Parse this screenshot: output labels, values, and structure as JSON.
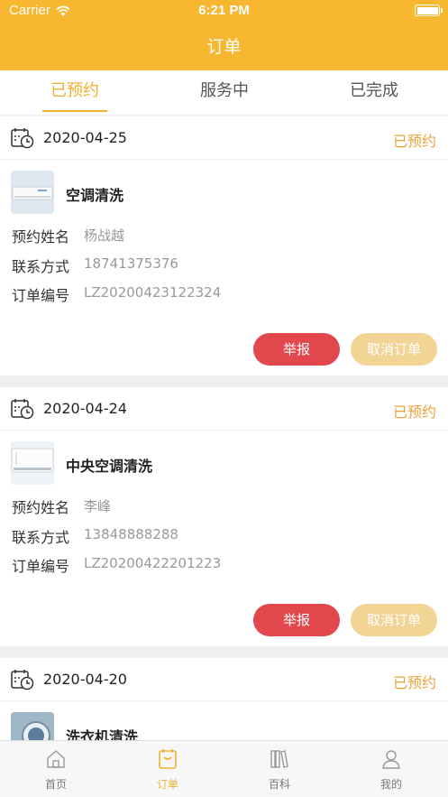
{
  "status_bar": {
    "carrier": "Carrier",
    "time": "6:21 PM"
  },
  "nav": {
    "title": "订单"
  },
  "tabs": [
    {
      "label": "已预约",
      "active": true
    },
    {
      "label": "服务中",
      "active": false
    },
    {
      "label": "已完成",
      "active": false
    }
  ],
  "orders": [
    {
      "date": "2020-04-25",
      "status": "已预约",
      "service": "空调清洗",
      "name_label": "预约姓名",
      "name": "杨战越",
      "phone_label": "联系方式",
      "phone": "18741375376",
      "order_label": "订单编号",
      "order_no": "LZ20200423122324",
      "report_label": "举报",
      "cancel_label": "取消订单"
    },
    {
      "date": "2020-04-24",
      "status": "已预约",
      "service": "中央空调清洗",
      "name_label": "预约姓名",
      "name": "李峰",
      "phone_label": "联系方式",
      "phone": "13848888288",
      "order_label": "订单编号",
      "order_no": "LZ20200422201223",
      "report_label": "举报",
      "cancel_label": "取消订单"
    },
    {
      "date": "2020-04-20",
      "status": "已预约",
      "service": "洗衣机清洗"
    }
  ],
  "tabbar": [
    {
      "label": "首页",
      "icon": "home-icon",
      "active": false
    },
    {
      "label": "订单",
      "icon": "order-icon",
      "active": true
    },
    {
      "label": "百科",
      "icon": "books-icon",
      "active": false
    },
    {
      "label": "我的",
      "icon": "profile-icon",
      "active": false
    }
  ],
  "colors": {
    "brand": "#f7b731",
    "accent": "#f0b232",
    "status": "#f0a13a",
    "report": "#e2474d",
    "cancel": "#f2d494"
  }
}
